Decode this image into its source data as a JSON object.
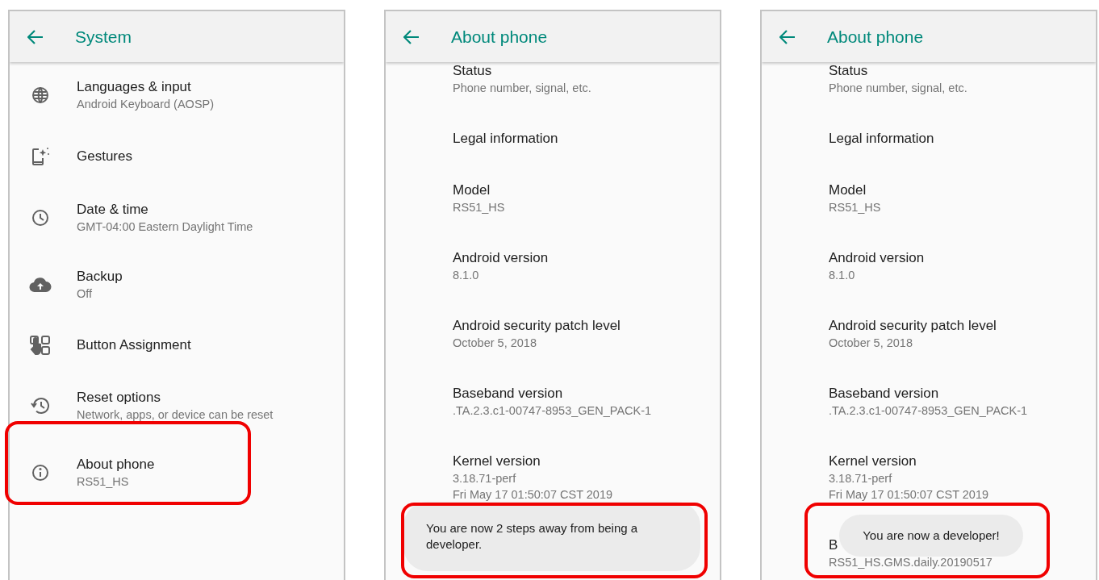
{
  "panels": [
    {
      "kind": "menu",
      "title": "System",
      "items": [
        {
          "title": "Languages & input",
          "summary": [
            "Android Keyboard (AOSP)"
          ],
          "highlighted": false
        },
        {
          "title": "Gestures",
          "highlighted": false
        },
        {
          "title": "Date & time",
          "summary": [
            "GMT-04:00 Eastern Daylight Time"
          ],
          "highlighted": false
        },
        {
          "title": "Backup",
          "summary": [
            "Off"
          ],
          "highlighted": false
        },
        {
          "title": "Button Assignment",
          "highlighted": false
        },
        {
          "title": "Reset options",
          "summary": [
            "Network, apps, or device can be reset"
          ],
          "highlighted": false
        },
        {
          "title": "About phone",
          "summary": [
            "RS51_HS"
          ],
          "highlighted": true
        }
      ]
    },
    {
      "kind": "info",
      "title": "About phone",
      "items": [
        {
          "title": "Status",
          "summary": [
            "Phone number, signal, etc."
          ]
        },
        {
          "title": "Legal information"
        },
        {
          "title": "Model",
          "summary": [
            "RS51_HS"
          ]
        },
        {
          "title": "Android version",
          "summary": [
            "8.1.0"
          ]
        },
        {
          "title": "Android security patch level",
          "summary": [
            "October 5, 2018"
          ]
        },
        {
          "title": "Baseband version",
          "summary": [
            ".TA.2.3.c1-00747-8953_GEN_PACK-1"
          ]
        },
        {
          "title": "Kernel version",
          "summary": [
            "3.18.71-perf",
            "Fri May 17 01:50:07 CST 2019"
          ]
        }
      ],
      "toast": {
        "kind": "wide",
        "text": "You are now 2 steps away from being a developer.",
        "highlighted": true
      }
    },
    {
      "kind": "info",
      "title": "About phone",
      "items": [
        {
          "title": "Status",
          "summary": [
            "Phone number, signal, etc."
          ]
        },
        {
          "title": "Legal information"
        },
        {
          "title": "Model",
          "summary": [
            "RS51_HS"
          ]
        },
        {
          "title": "Android version",
          "summary": [
            "8.1.0"
          ]
        },
        {
          "title": "Android security patch level",
          "summary": [
            "October 5, 2018"
          ]
        },
        {
          "title": "Baseband version",
          "summary": [
            ".TA.2.3.c1-00747-8953_GEN_PACK-1"
          ]
        },
        {
          "title": "Kernel version",
          "summary": [
            "3.18.71-perf",
            "Fri May 17 01:50:07 CST 2019"
          ]
        },
        {
          "title": "B",
          "summary": [
            "RS51_HS.GMS.daily.20190517"
          ]
        }
      ],
      "toast": {
        "kind": "compact",
        "text": "You are now a developer!",
        "highlighted": true
      }
    }
  ]
}
